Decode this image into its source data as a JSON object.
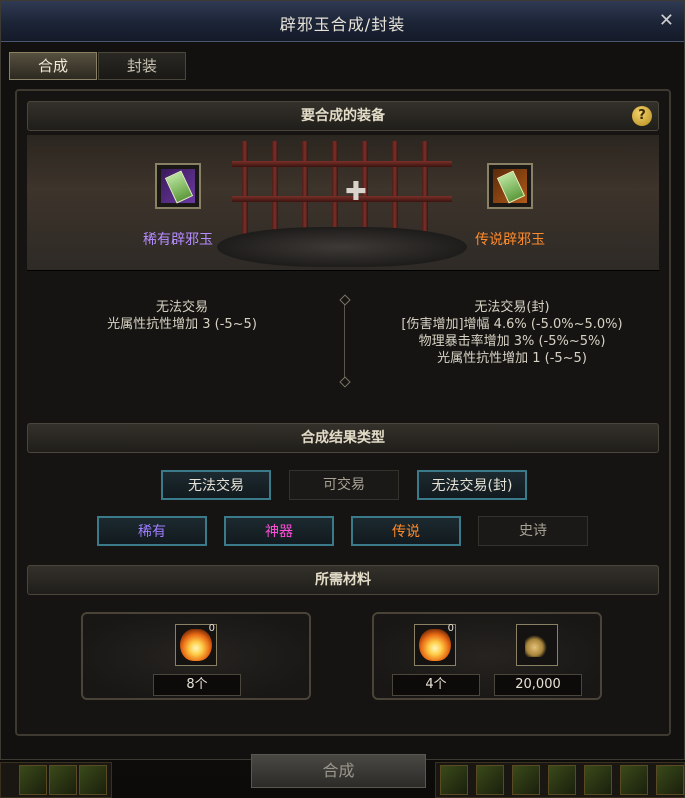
{
  "window": {
    "title": "辟邪玉合成/封装",
    "close_icon": "✕"
  },
  "tabs": [
    {
      "label": "合成"
    },
    {
      "label": "封装"
    }
  ],
  "equip_section": {
    "header": "要合成的装备",
    "help_icon": "?",
    "left_item": {
      "name": "稀有辟邪玉",
      "color": "#b58cff"
    },
    "right_item": {
      "name": "传说辟邪玉",
      "color": "#ff8a2a"
    },
    "left_attrs": [
      "无法交易",
      "光属性抗性增加 3 (-5~5)"
    ],
    "right_attrs": [
      "无法交易(封)",
      "[伤害增加]增幅 4.6% (-5.0%~5.0%)",
      "物理暴击率增加 3% (-5%~5%)",
      "光属性抗性增加 1 (-5~5)"
    ]
  },
  "result_section": {
    "header": "合成结果类型",
    "trade_options": [
      {
        "label": "无法交易",
        "selected": true
      },
      {
        "label": "可交易",
        "selected": false
      },
      {
        "label": "无法交易(封)",
        "selected": true
      }
    ],
    "rarity_options": [
      {
        "label": "稀有",
        "color": "#9e7dff",
        "selected": true
      },
      {
        "label": "神器",
        "color": "#ff4dd8",
        "selected": true
      },
      {
        "label": "传说",
        "color": "#ff8a2a",
        "selected": true
      },
      {
        "label": "史诗",
        "color": "#a8a294",
        "selected": false
      }
    ]
  },
  "materials_section": {
    "header": "所需材料",
    "left": {
      "badge": "0",
      "count": "8个"
    },
    "right": {
      "badge": "0",
      "count": "4个",
      "gold": "20,000"
    }
  },
  "synthesize_button": "合成"
}
